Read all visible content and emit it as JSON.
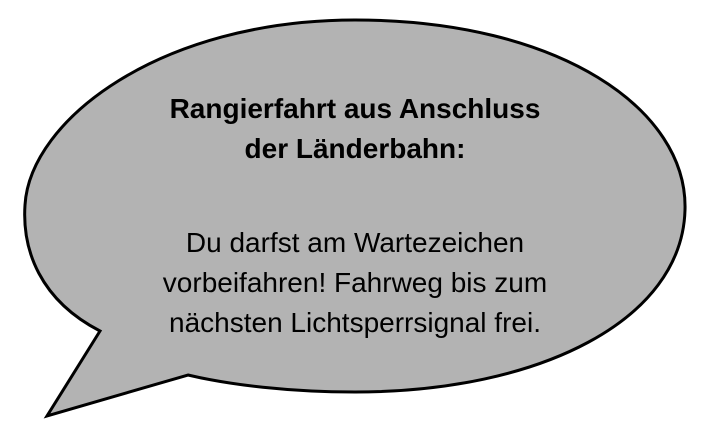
{
  "bubble": {
    "fill_color": "#b3b3b3",
    "stroke_color": "#000000",
    "title_lines": [
      "Rangierfahrt aus Anschluss",
      "der Länderbahn:"
    ],
    "message_lines": [
      "Du darfst am Wartezeichen",
      "vorbeifahren! Fahrweg bis zum",
      "nächsten Lichtsperrsignal frei."
    ]
  }
}
